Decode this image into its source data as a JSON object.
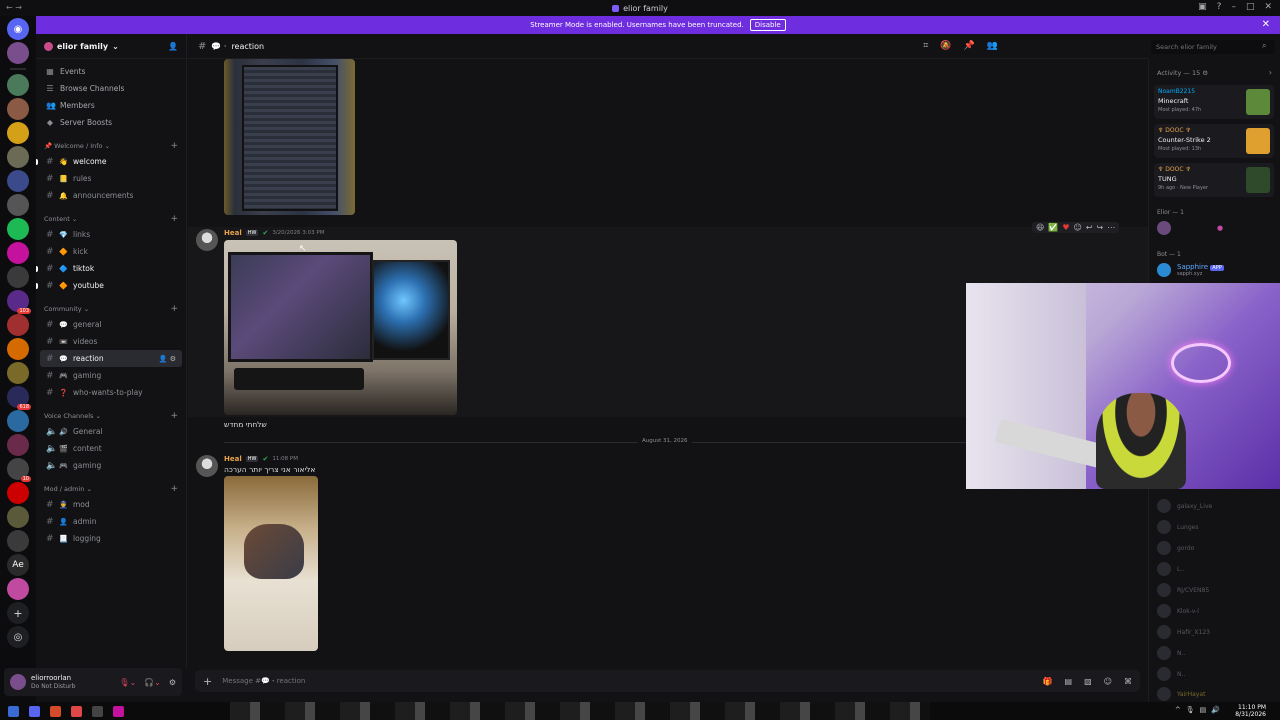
{
  "window": {
    "title": "elior family"
  },
  "banner": {
    "text": "Streamer Mode is enabled. Usernames have been truncated.",
    "disable_label": "Disable"
  },
  "guild": {
    "name": "elior family"
  },
  "nav": [
    "Events",
    "Browse Channels",
    "Members",
    "Server Boosts"
  ],
  "categories": [
    {
      "name": "Welcome / Info",
      "channels": [
        {
          "emoji": "👋",
          "name": "welcome",
          "unread": true
        },
        {
          "emoji": "📒",
          "name": "rules",
          "unread": false
        },
        {
          "emoji": "🔔",
          "name": "announcements",
          "unread": false
        }
      ]
    },
    {
      "name": "Content",
      "channels": [
        {
          "emoji": "💎",
          "name": "links",
          "unread": false
        },
        {
          "emoji": "🔶",
          "name": "kick",
          "unread": false
        },
        {
          "emoji": "🔷",
          "name": "tiktok",
          "unread": true
        },
        {
          "emoji": "🔶",
          "name": "youtube",
          "unread": true
        }
      ]
    },
    {
      "name": "Community",
      "channels": [
        {
          "emoji": "💬",
          "name": "general",
          "unread": false
        },
        {
          "emoji": "📼",
          "name": "videos",
          "unread": false
        },
        {
          "emoji": "💬",
          "name": "reaction",
          "unread": false,
          "active": true
        },
        {
          "emoji": "🎮",
          "name": "gaming",
          "unread": false
        },
        {
          "emoji": "❓",
          "name": "who-wants-to-play",
          "unread": false
        }
      ]
    },
    {
      "name": "Voice Channels",
      "channels": [
        {
          "emoji": "🔊",
          "name": "General"
        },
        {
          "emoji": "🎬",
          "name": "content"
        },
        {
          "emoji": "🎮",
          "name": "gaming"
        }
      ]
    },
    {
      "name": "Mod / admin",
      "channels": [
        {
          "emoji": "👮",
          "name": "mod"
        },
        {
          "emoji": "👤",
          "name": "admin"
        },
        {
          "emoji": "📃",
          "name": "logging"
        }
      ]
    }
  ],
  "user": {
    "name": "eliorroorlan",
    "status": "Do Not Disturb"
  },
  "channel": {
    "name": "reaction"
  },
  "search": {
    "placeholder": "Search elior family"
  },
  "messages": {
    "msg1": {
      "author": "Heal",
      "tag": "HW",
      "timestamp": "3/20/2026 3:03 PM"
    },
    "text1": "שלחתי מחדש",
    "date_divider": "August 31, 2026",
    "msg2": {
      "author": "Heal",
      "tag": "HW",
      "timestamp": "11:08 PM",
      "text": "אליאור אני צריך יותר הערכה"
    }
  },
  "composer": {
    "placeholder": "Message #💬・reaction"
  },
  "activity": {
    "header": "Activity — 15",
    "cards": [
      {
        "name": "NoamB2215",
        "game": "Minecraft",
        "meta": "Most played: 47h",
        "color": "#5d8a3a"
      },
      {
        "name": "♆ DOOC ♆",
        "game": "Counter-Strike 2",
        "meta": "Most played: 13h",
        "color": "#e0a030"
      },
      {
        "name": "♆ DOOC ♆",
        "game": "TUNG",
        "meta": "9h ago · New Player",
        "color": "#2f4a2a"
      }
    ]
  },
  "members": {
    "group1": "Elior — 1",
    "group2": "Bot — 1",
    "bot": {
      "name": "Sapphire",
      "badge": "APP",
      "sub": "sapph.xyz"
    },
    "faded": [
      "galaxy_Live",
      "Lunges",
      "gordo",
      "L..",
      "RJ/CVEN85",
      "Klok-v-l",
      "Hafir_X123",
      "N..",
      "N..",
      "YairHayat"
    ]
  },
  "taskbar": {
    "time": "11:10 PM",
    "date": "8/31/2026"
  }
}
